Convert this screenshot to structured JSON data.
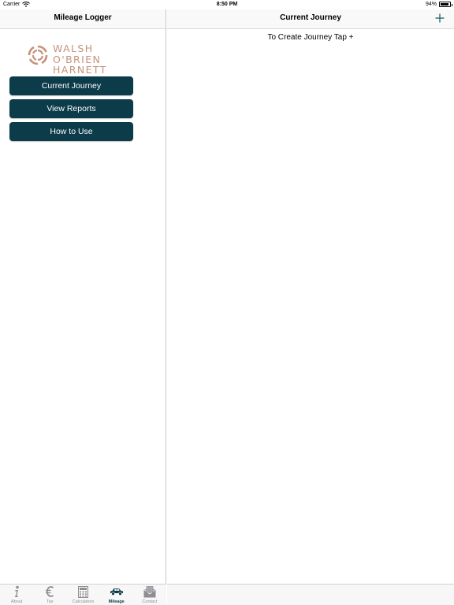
{
  "status_bar": {
    "carrier": "Carrier",
    "time": "8:50 PM",
    "battery": "94%",
    "battery_level": 0.94
  },
  "master": {
    "title": "Mileage Logger",
    "logo": {
      "line1": "WALSH",
      "line2": "O'BRIEN",
      "line3": "HARNETT",
      "color": "#c5937a"
    },
    "menu": [
      {
        "label": "Current Journey"
      },
      {
        "label": "View Reports"
      },
      {
        "label": "How to Use"
      }
    ],
    "button_color": "#0c3b4a"
  },
  "detail": {
    "title": "Current Journey",
    "add_icon": "plus-icon",
    "hint": "To Create Journey Tap +"
  },
  "tabbar": {
    "tabs": [
      {
        "label": "About",
        "icon": "info-icon"
      },
      {
        "label": "Tax",
        "icon": "euro-icon"
      },
      {
        "label": "Calculators",
        "icon": "calculator-icon"
      },
      {
        "label": "Mileage",
        "icon": "car-icon",
        "active": true
      },
      {
        "label": "Contact",
        "icon": "mail-icon"
      }
    ]
  }
}
